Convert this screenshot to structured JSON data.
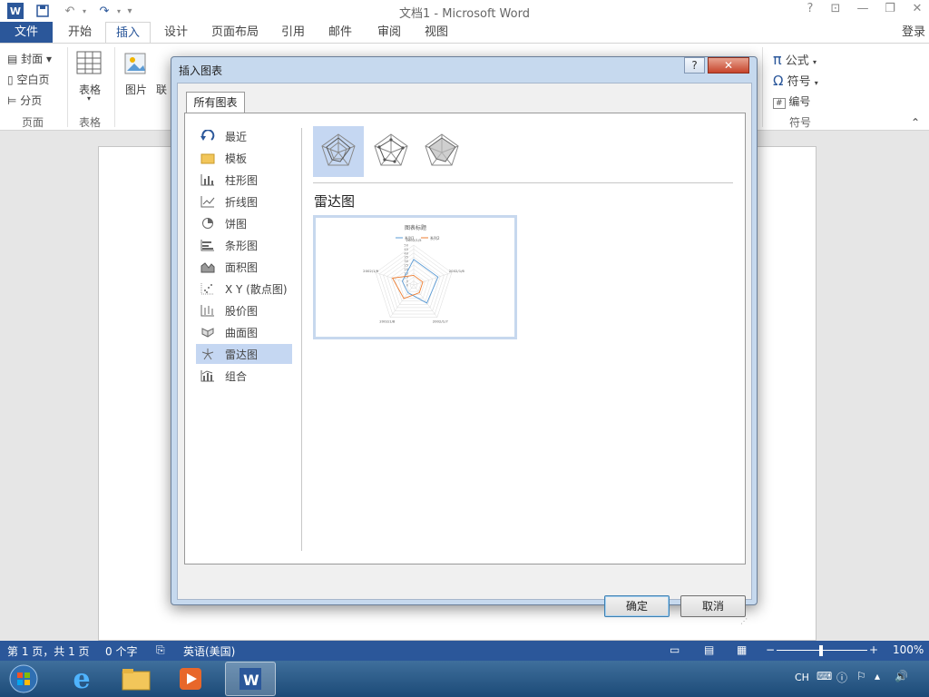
{
  "window": {
    "title": "文档1 - Microsoft Word",
    "help": "?",
    "signin": "登录"
  },
  "tabs": [
    {
      "label": "文件"
    },
    {
      "label": "开始"
    },
    {
      "label": "插入"
    },
    {
      "label": "设计"
    },
    {
      "label": "页面布局"
    },
    {
      "label": "引用"
    },
    {
      "label": "邮件"
    },
    {
      "label": "审阅"
    },
    {
      "label": "视图"
    }
  ],
  "ribbon": {
    "cover": "封面",
    "blank_page": "空白页",
    "page_break": "分页",
    "group_pages": "页面",
    "table": "表格",
    "group_table": "表格",
    "picture": "图片",
    "online_pic": "联",
    "equation": "公式",
    "symbol": "符号",
    "numbering": "编号",
    "group_symbols": "符号"
  },
  "dialog": {
    "title": "插入图表",
    "tab": "所有图表",
    "categories": [
      {
        "label": "最近"
      },
      {
        "label": "模板"
      },
      {
        "label": "柱形图"
      },
      {
        "label": "折线图"
      },
      {
        "label": "饼图"
      },
      {
        "label": "条形图"
      },
      {
        "label": "面积图"
      },
      {
        "label": "X Y (散点图)"
      },
      {
        "label": "股价图"
      },
      {
        "label": "曲面图"
      },
      {
        "label": "雷达图"
      },
      {
        "label": "组合"
      }
    ],
    "selected_category": "雷达图",
    "chart_name": "雷达图",
    "ok": "确定",
    "cancel": "取消"
  },
  "preview": {
    "title": "图表标题",
    "legend": [
      "系列1",
      "系列2"
    ],
    "axis_labels": [
      "2002/1/5",
      "2002/1/6",
      "2002/1/7",
      "2002/1/8",
      "2002/1/9"
    ],
    "ticks": [
      "50",
      "45",
      "40",
      "35",
      "30",
      "25",
      "20",
      "15",
      "10",
      "5",
      "0"
    ]
  },
  "chart_data": {
    "type": "radar",
    "title": "图表标题",
    "categories": [
      "2002/1/5",
      "2002/1/6",
      "2002/1/7",
      "2002/1/8",
      "2002/1/9"
    ],
    "series": [
      {
        "name": "系列1",
        "values": [
          32,
          32,
          28,
          12,
          15
        ]
      },
      {
        "name": "系列2",
        "values": [
          12,
          12,
          12,
          21,
          28
        ]
      }
    ],
    "ylim": [
      0,
      50
    ],
    "colors": {
      "系列1": "#5b9bd5",
      "系列2": "#ed7d31"
    }
  },
  "status": {
    "page": "第 1 页，共 1 页",
    "words": "0 个字",
    "lang": "英语(美国)",
    "zoom": "100%"
  },
  "taskbar": {
    "lang": "CH"
  }
}
